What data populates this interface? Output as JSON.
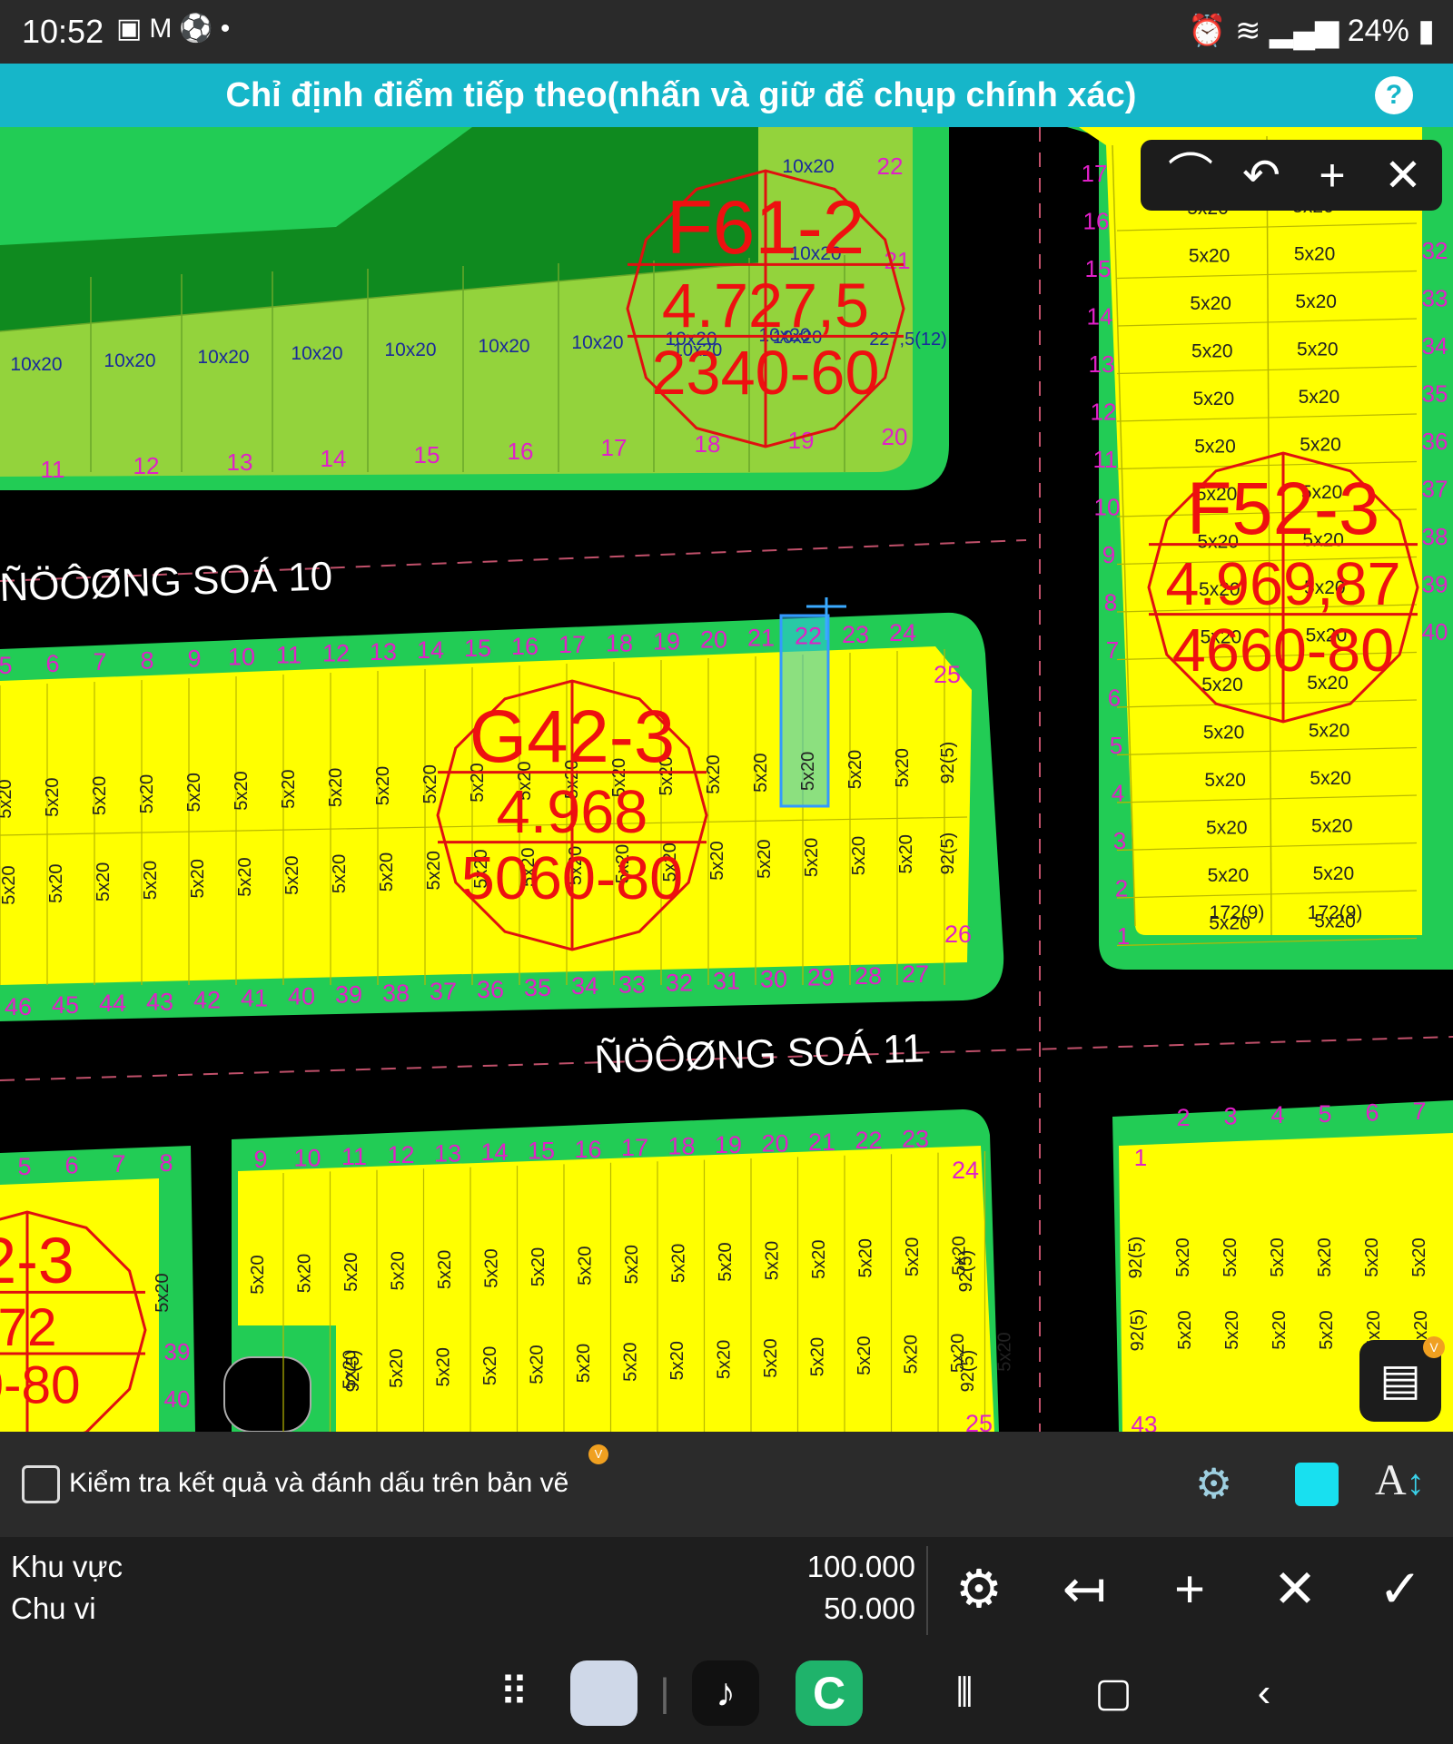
{
  "status_bar": {
    "time": "10:52",
    "notif_icons": [
      "image-icon",
      "gmail-icon",
      "football-icon",
      "dot-icon"
    ],
    "battery": "24%"
  },
  "instruction_bar": {
    "text": "Chỉ định điểm tiếp theo(nhấn và giữ để chụp chính xác)",
    "help_label": "?"
  },
  "map": {
    "roads": [
      "ÑÖÔØNG SOÁ  10",
      "ÑÖÔØNG SOÁ 11"
    ],
    "blocks": [
      {
        "id": "F61-2",
        "l1": "F61-2",
        "l2": "4.727,5",
        "l3": "2340-60"
      },
      {
        "id": "G42-3",
        "l1": "G42-3",
        "l2": "4.968",
        "l3": "5060-80"
      },
      {
        "id": "F52-3",
        "l1": "F52-3",
        "l2": "4.969,87",
        "l3": "4660-80"
      },
      {
        "id": "L23",
        "l1": "2-3",
        "l2": "72",
        "l3": "0-80"
      }
    ],
    "lot_size_10x20": "10x20",
    "lot_size_5x20": "5x20",
    "corner_label": "92(5)",
    "f5_corner": "172(9)",
    "f6_corner": "227,5(12)",
    "g4_top_numbers": [
      "5",
      "6",
      "7",
      "8",
      "9",
      "10",
      "11",
      "12",
      "13",
      "14",
      "15",
      "16",
      "17",
      "18",
      "19",
      "20",
      "21",
      "22",
      "23",
      "24"
    ],
    "g4_bottom_numbers": [
      "46",
      "45",
      "44",
      "43",
      "42",
      "41",
      "40",
      "39",
      "38",
      "37",
      "36",
      "35",
      "34",
      "33",
      "32",
      "31",
      "30",
      "29",
      "28",
      "27"
    ],
    "g4_side_top": "25",
    "g4_side_bottom": "26",
    "f6_numbers": [
      "11",
      "12",
      "13",
      "14",
      "15",
      "16",
      "17",
      "18",
      "19",
      "20"
    ],
    "f6_right_numbers": [
      "22",
      "21"
    ],
    "f5_left_numbers": [
      "17",
      "16",
      "15",
      "14",
      "13",
      "12",
      "11",
      "10",
      "9",
      "8",
      "7",
      "6",
      "5",
      "4",
      "3",
      "2",
      "1"
    ],
    "f5_right_numbers": [
      "32",
      "33",
      "34",
      "35",
      "36",
      "37",
      "38",
      "39",
      "40"
    ],
    "bottom_numbers": [
      "9",
      "10",
      "11",
      "12",
      "13",
      "14",
      "15",
      "16",
      "17",
      "18",
      "19",
      "20",
      "21",
      "22",
      "23"
    ],
    "bottom_side": [
      "24",
      "25"
    ],
    "bl_numbers": [
      "5",
      "6",
      "7",
      "8"
    ],
    "bl_side": [
      "39",
      "40"
    ],
    "br_numbers": [
      "2",
      "3",
      "4",
      "5",
      "6",
      "7"
    ],
    "br_side": [
      "1",
      "43"
    ],
    "highlight_lot": "22"
  },
  "toolbox": {
    "icons": [
      "arc-icon",
      "undo-icon",
      "plus-icon",
      "close-icon"
    ]
  },
  "calendar": {
    "icon": "calendar-icon",
    "badge": "V"
  },
  "options_bar": {
    "checkbox_label": "Kiểm tra kết quả và đánh dấu trên bản vẽ",
    "badge": "V",
    "color_swatch": "#18e0f0",
    "text_size_label": "A"
  },
  "measure": {
    "area_label": "Khu vực",
    "area_value": "100.000",
    "perimeter_label": "Chu vi",
    "perimeter_value": "50.000",
    "actions": [
      "settings-icon",
      "undo-icon",
      "add-icon",
      "close-icon",
      "check-icon"
    ]
  },
  "nav": {
    "items": [
      "apps-grid-icon",
      "app-folder-icon",
      "tiktok-icon",
      "c-app-icon",
      "recents-icon",
      "home-icon",
      "back-icon"
    ]
  }
}
